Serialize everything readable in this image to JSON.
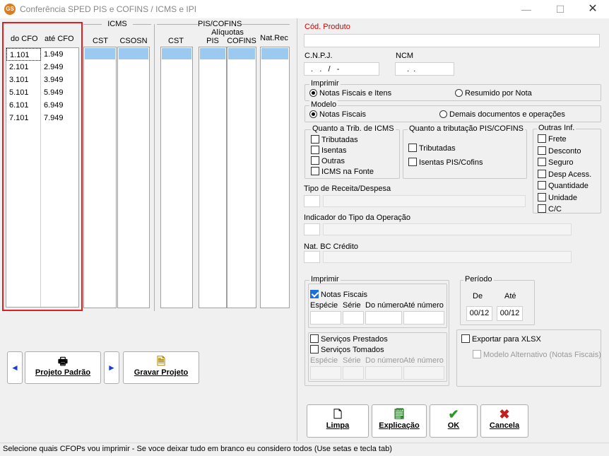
{
  "window": {
    "title": "Conferência SPED PIS e COFINS / ICMS e IPI",
    "icon_text": "GS",
    "minimize": "—",
    "maximize": "☐",
    "close": "✕"
  },
  "cfo": {
    "header_from": "do CFO",
    "header_to": "até CFO",
    "rows": [
      {
        "from": "1.101",
        "to": "1.949"
      },
      {
        "from": "2.101",
        "to": "2.949"
      },
      {
        "from": "3.101",
        "to": "3.949"
      },
      {
        "from": "5.101",
        "to": "5.949"
      },
      {
        "from": "6.101",
        "to": "6.949"
      },
      {
        "from": "7.101",
        "to": "7.949"
      }
    ]
  },
  "icms": {
    "group": "ICMS",
    "cst": "CST",
    "csosn": "CSOSN"
  },
  "piscofins": {
    "group": "PIS/COFINS",
    "cst": "CST",
    "aliquotas": "Alíquotas",
    "pis": "PIS",
    "cofins": "COFINS",
    "natrec": "Nat.Rec"
  },
  "nav": {
    "prev_icon": "◄",
    "next_icon": "►",
    "projeto_padrao": "Projeto Padrão",
    "gravar_projeto": "Gravar Projeto"
  },
  "form": {
    "cod_produto_label": "Cód. Produto",
    "cod_produto_value": "",
    "cnpj_label": "C.N.P.J.",
    "cnpj_value": " .   .   /   -",
    "ncm_label": "NCM",
    "ncm_value": "  .  .",
    "imprimir_label": "Imprimir",
    "radio_notas_itens": "Notas Fiscais e Itens",
    "radio_resumido": "Resumido por Nota",
    "modelo_label": "Modelo",
    "radio_notas_fiscais": "Notas Fiscais",
    "radio_demais": "Demais documentos e operações",
    "trib_icms_label": "Quanto a Trib. de ICMS",
    "icms_opts": [
      "Tributadas",
      "Isentas",
      "Outras",
      "ICMS na Fonte"
    ],
    "trib_pis_label": "Quanto a tributação PIS/COFINS",
    "pis_opts": [
      "Tributadas",
      "Isentas PIS/Cofins"
    ],
    "outras_label": "Outras Inf.",
    "outras_opts": [
      "Frete",
      "Desconto",
      "Seguro",
      "Desp Acess.",
      "Quantidade",
      "Unidade",
      "C/C"
    ],
    "tipo_receita_label": "Tipo de Receita/Despesa",
    "indicador_label": "Indicador do Tipo da Operação",
    "natbc_label": "Nat. BC Crédito",
    "imprimir2_label": "Imprimir",
    "chk_notas_fiscais": "Notas Fiscais",
    "col_especie": "Espécie",
    "col_serie": "Série",
    "col_do_numero": "Do número",
    "col_ate_numero": "Até número",
    "chk_servicos_prestados": "Serviços Prestados",
    "chk_servicos_tomados": "Serviços Tomados",
    "periodo_label": "Período",
    "de_label": "De",
    "ate_label": "Até",
    "de_value": "00/12",
    "ate_value": "00/12",
    "exportar_label": "Exportar para XLSX",
    "modelo_alt_label": "Modelo Alternativo (Notas Fiscais)"
  },
  "actions": {
    "limpa": "Limpa",
    "explicacao": "Explicação",
    "ok": "OK",
    "cancela": "Cancela"
  },
  "status": {
    "text": "Selecione quais CFOPs vou imprimir - Se voce deixar tudo em branco eu considero todos (Use setas e tecla tab)"
  }
}
